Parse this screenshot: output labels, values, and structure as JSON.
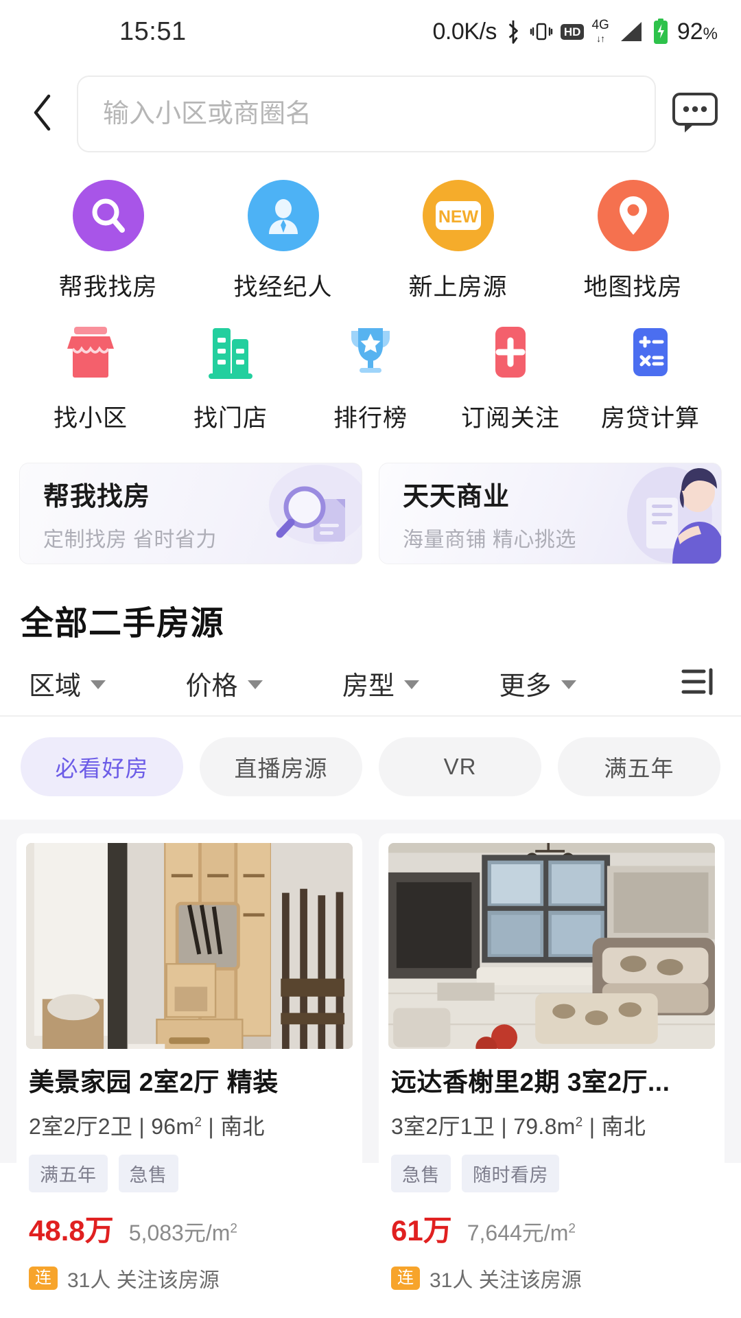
{
  "statusbar": {
    "time": "15:51",
    "net_speed": "0.0K/s",
    "bluetooth_icon": "bluetooth-icon",
    "vibrate_icon": "vibrate-icon",
    "hd_label": "HD",
    "signal_label": "4G",
    "signal_sub": "↓↑",
    "battery_percent": "92",
    "battery_percent_symbol": "%"
  },
  "header": {
    "back_icon": "chevron-left-icon",
    "search_placeholder": "输入小区或商圈名",
    "search_value": "",
    "message_icon": "message-icon"
  },
  "quick_actions": {
    "row1": [
      {
        "label": "帮我找房",
        "icon": "search-circle-icon",
        "color": "#a855e8"
      },
      {
        "label": "找经纪人",
        "icon": "agent-person-icon",
        "color": "#4db2f5"
      },
      {
        "label": "新上房源",
        "icon": "new-badge-icon",
        "color": "#f5ac2b",
        "badge_text": "NEW"
      },
      {
        "label": "地图找房",
        "icon": "map-pin-icon",
        "color": "#f5714f"
      }
    ],
    "row2": [
      {
        "label": "找小区",
        "icon": "storefront-icon",
        "color": "#f4606c"
      },
      {
        "label": "找门店",
        "icon": "buildings-icon",
        "color": "#23cf9e"
      },
      {
        "label": "排行榜",
        "icon": "trophy-icon",
        "color": "#57b3f0"
      },
      {
        "label": "订阅关注",
        "icon": "plus-subscribe-icon",
        "color": "#f4606c"
      },
      {
        "label": "房贷计算",
        "icon": "calculator-icon",
        "color": "#4b6ef0"
      }
    ]
  },
  "promos": [
    {
      "title": "帮我找房",
      "subtitle": "定制找房 省时省力",
      "art_icon": "magnifier-document-icon"
    },
    {
      "title": "天天商业",
      "subtitle": "海量商铺 精心挑选",
      "art_icon": "person-tablet-icon"
    }
  ],
  "section": {
    "title": "全部二手房源"
  },
  "filters": {
    "items": [
      {
        "label": "区域"
      },
      {
        "label": "价格"
      },
      {
        "label": "房型"
      },
      {
        "label": "更多"
      }
    ],
    "sort_icon": "sort-list-icon"
  },
  "chips": [
    {
      "label": "必看好房",
      "active": true
    },
    {
      "label": "直播房源",
      "active": false
    },
    {
      "label": "VR",
      "active": false
    },
    {
      "label": "满五年",
      "active": false
    }
  ],
  "listings": [
    {
      "title": "美景家园 2室2厅 精装",
      "meta_layout": "2室2厅2卫",
      "meta_area": "96m",
      "meta_area_sup": "2",
      "meta_orientation": "南北",
      "tags": [
        "满五年",
        "急售"
      ],
      "price": "48.8万",
      "unit_price": "5,083元/m",
      "unit_price_sup": "2",
      "foot_badge": "连",
      "foot_text": "31人 关注该房源"
    },
    {
      "title": "远达香榭里2期 3室2厅...",
      "meta_layout": "3室2厅1卫",
      "meta_area": "79.8m",
      "meta_area_sup": "2",
      "meta_orientation": "南北",
      "tags": [
        "急售",
        "随时看房"
      ],
      "price": "61万",
      "unit_price": "7,644元/m",
      "unit_price_sup": "2",
      "foot_badge": "连",
      "foot_text": "31人 关注该房源"
    }
  ],
  "colors": {
    "accent_purple": "#6c5ce7",
    "price_red": "#e02020"
  }
}
